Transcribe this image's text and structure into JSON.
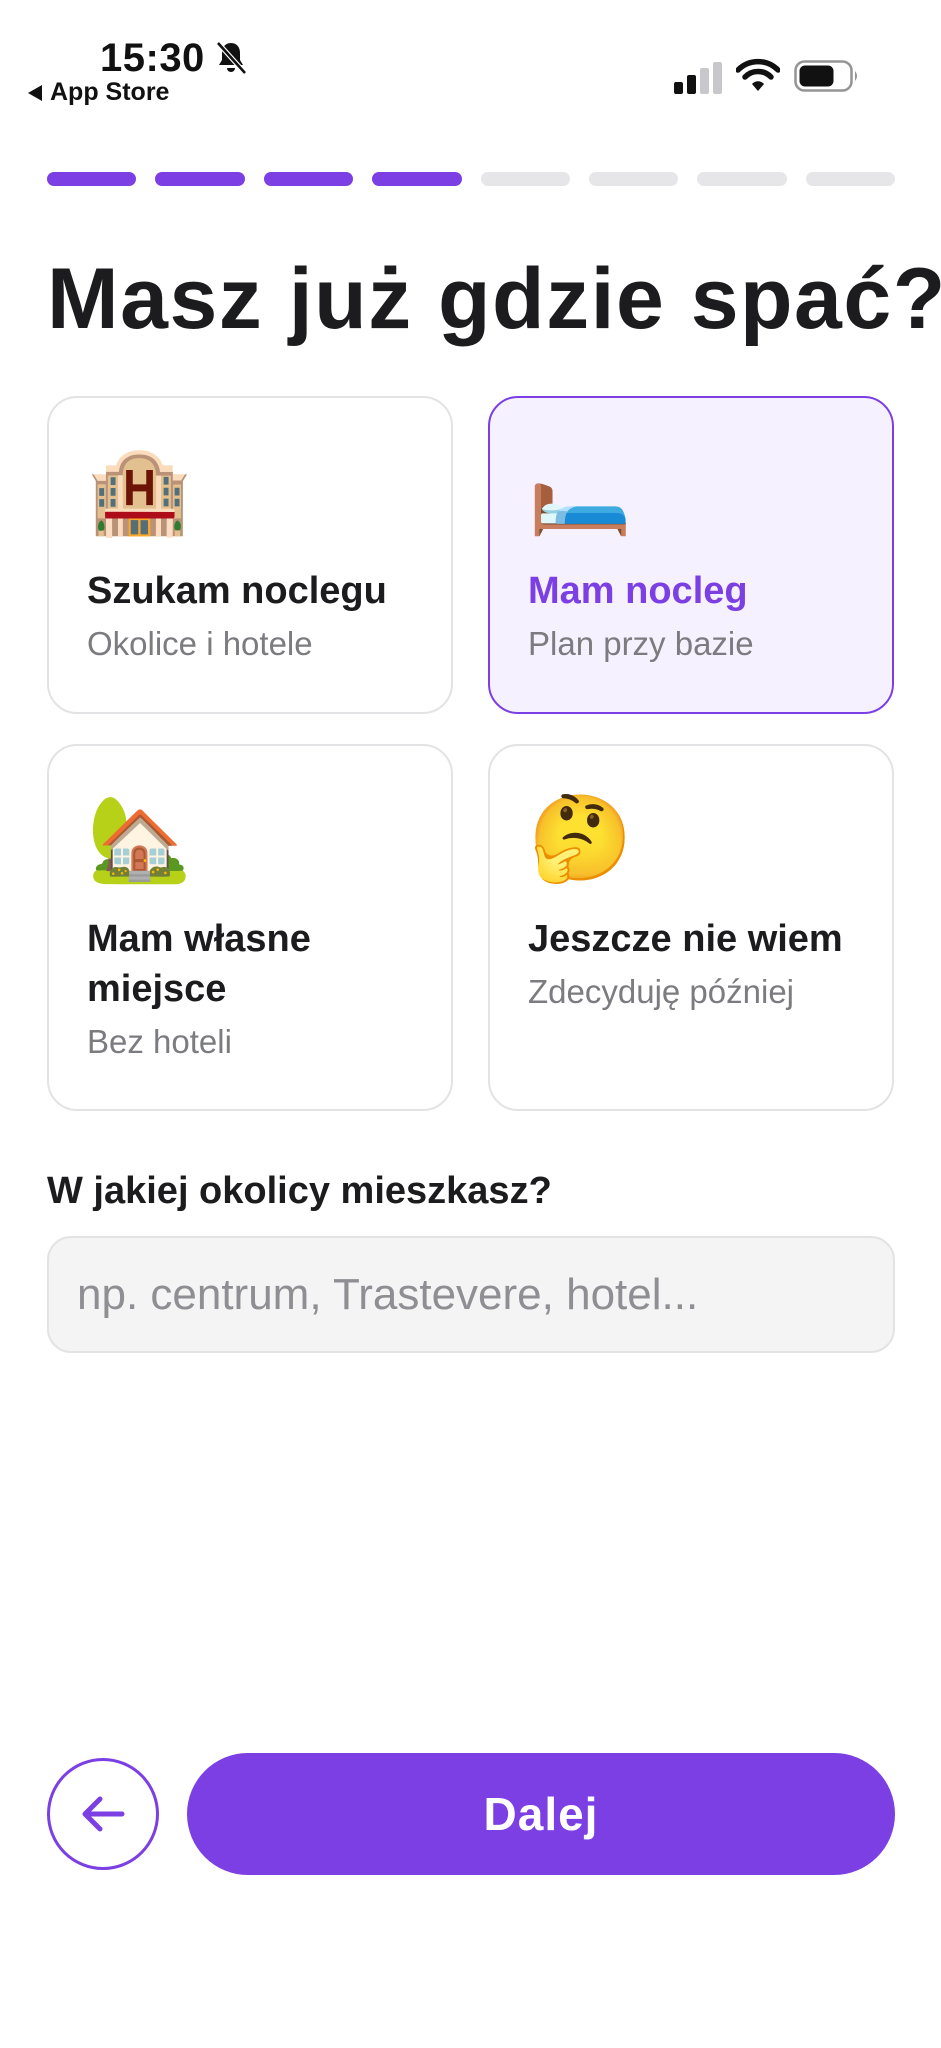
{
  "status_bar": {
    "time": "15:30",
    "back_label": "App Store",
    "icons": [
      "bell-slash-icon",
      "signal-icon",
      "wifi-icon",
      "battery-icon"
    ]
  },
  "progress": {
    "total_steps": 8,
    "completed_steps": 4,
    "active_color": "#7b3fe4"
  },
  "title": "Masz już gdzie spać?",
  "options": [
    {
      "emoji": "🏨",
      "label": "Szukam noclegu",
      "sub": "Okolice i hotele",
      "selected": false
    },
    {
      "emoji": "🛏️",
      "label": "Mam nocleg",
      "sub": "Plan przy bazie",
      "selected": true
    },
    {
      "emoji": "🏡",
      "label": "Mam własne miejsce",
      "sub": "Bez hoteli",
      "selected": false
    },
    {
      "emoji": "🤔",
      "label": "Jeszcze nie wiem",
      "sub": "Zdecyduję później",
      "selected": false
    }
  ],
  "neighborhood": {
    "question": "W jakiej okolicy mieszkasz?",
    "value": "",
    "placeholder": "np. centrum, Trastevere, hotel..."
  },
  "footer": {
    "back_icon": "arrow-left-icon",
    "next_label": "Dalej"
  },
  "colors": {
    "accent": "#7b3fe4",
    "selected_bg": "#f6f1fe",
    "muted": "#7b7b80"
  }
}
